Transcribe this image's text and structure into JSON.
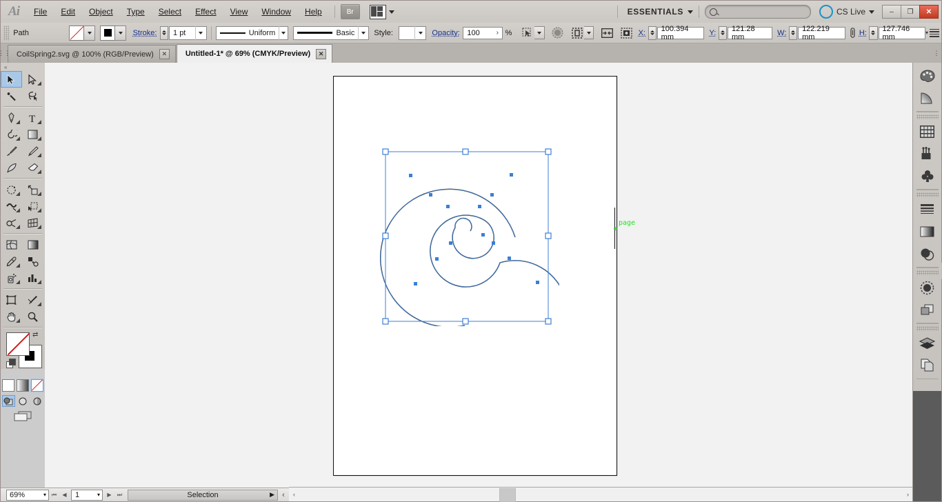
{
  "app": {
    "name": "Adobe Illustrator",
    "logo_text": "Ai"
  },
  "menubar": {
    "items": [
      {
        "label": "File"
      },
      {
        "label": "Edit"
      },
      {
        "label": "Object"
      },
      {
        "label": "Type"
      },
      {
        "label": "Select"
      },
      {
        "label": "Effect"
      },
      {
        "label": "View"
      },
      {
        "label": "Window"
      },
      {
        "label": "Help"
      }
    ],
    "bridge_label": "Br",
    "arrange_icon": "arrange-documents-icon",
    "workspace": "ESSENTIALS",
    "search_placeholder": "",
    "cs_live_label": "CS Live",
    "window_buttons": {
      "minimize": "–",
      "restore": "❐",
      "close": "✕"
    }
  },
  "control_bar": {
    "object_type": "Path",
    "fill_label": "Fill",
    "fill_value": "None",
    "stroke_color_label": "Stroke Color",
    "stroke_color_value": "Black",
    "stroke_label": "Stroke:",
    "stroke_weight": "1 pt",
    "variable_width_profile": "Uniform",
    "brush_definition": "Basic",
    "style_label": "Style:",
    "style_value": "",
    "opacity_label": "Opacity:",
    "opacity_value": "100",
    "opacity_unit": "%",
    "opacity_more": "›",
    "align_icon": "align-to-selection-icon",
    "transform_icon": "transform-icon",
    "isolate_icon": "isolate-selected-object-icon",
    "mask_icon": "edit-clipping-mask-icon",
    "recolor_icon": "recolor-artwork-icon",
    "x_label": "X:",
    "x_value": "100.394 mm",
    "y_label": "Y:",
    "y_value": "121.28 mm",
    "w_label": "W:",
    "w_value": "122.219 mm",
    "link_icon": "constrain-proportions-icon",
    "h_label": "H:",
    "h_value": "127.746 mm",
    "panel_menu_icon": "panel-menu-icon"
  },
  "document_tabs": [
    {
      "label": "CoilSpring2.svg @ 100% (RGB/Preview)",
      "active": false,
      "close": "✕"
    },
    {
      "label": "Untitled-1* @ 69% (CMYK/Preview)",
      "active": true,
      "close": "✕"
    }
  ],
  "toolbox": {
    "tools": [
      {
        "name": "selection-tool",
        "selected": true,
        "has_flyout": false
      },
      {
        "name": "direct-selection-tool",
        "selected": false,
        "has_flyout": true
      },
      {
        "name": "magic-wand-tool",
        "selected": false,
        "has_flyout": false
      },
      {
        "name": "lasso-tool",
        "selected": false,
        "has_flyout": false
      },
      {
        "name": "pen-tool",
        "selected": false,
        "has_flyout": true
      },
      {
        "name": "type-tool",
        "selected": false,
        "has_flyout": true
      },
      {
        "name": "line-segment-tool",
        "selected": false,
        "has_flyout": true
      },
      {
        "name": "rectangle-tool",
        "selected": false,
        "has_flyout": true
      },
      {
        "name": "paintbrush-tool",
        "selected": false,
        "has_flyout": false
      },
      {
        "name": "pencil-tool",
        "selected": false,
        "has_flyout": true
      },
      {
        "name": "blob-brush-tool",
        "selected": false,
        "has_flyout": false
      },
      {
        "name": "eraser-tool",
        "selected": false,
        "has_flyout": true
      },
      {
        "name": "rotate-tool",
        "selected": false,
        "has_flyout": true
      },
      {
        "name": "scale-tool",
        "selected": false,
        "has_flyout": true
      },
      {
        "name": "width-tool",
        "selected": false,
        "has_flyout": true
      },
      {
        "name": "free-transform-tool",
        "selected": false,
        "has_flyout": false
      },
      {
        "name": "shape-builder-tool",
        "selected": false,
        "has_flyout": true
      },
      {
        "name": "perspective-grid-tool",
        "selected": false,
        "has_flyout": true
      },
      {
        "name": "mesh-tool",
        "selected": false,
        "has_flyout": false
      },
      {
        "name": "gradient-tool",
        "selected": false,
        "has_flyout": false
      },
      {
        "name": "eyedropper-tool",
        "selected": false,
        "has_flyout": true
      },
      {
        "name": "blend-tool",
        "selected": false,
        "has_flyout": false
      },
      {
        "name": "symbol-sprayer-tool",
        "selected": false,
        "has_flyout": true
      },
      {
        "name": "column-graph-tool",
        "selected": false,
        "has_flyout": true
      },
      {
        "name": "artboard-tool",
        "selected": false,
        "has_flyout": false
      },
      {
        "name": "slice-tool",
        "selected": false,
        "has_flyout": true
      },
      {
        "name": "hand-tool",
        "selected": false,
        "has_flyout": true
      },
      {
        "name": "zoom-tool",
        "selected": false,
        "has_flyout": false
      }
    ],
    "fill_name": "fill-swatch",
    "fill_value": "None",
    "stroke_name": "stroke-swatch",
    "stroke_value": "Black",
    "swap_label": "⇄",
    "color_modes": [
      {
        "name": "color-mode-button",
        "selected": false
      },
      {
        "name": "gradient-mode-button",
        "selected": false
      },
      {
        "name": "none-mode-button",
        "selected": true
      }
    ],
    "draw_modes": [
      {
        "name": "draw-normal-button",
        "selected": true
      },
      {
        "name": "draw-behind-button",
        "selected": false
      },
      {
        "name": "draw-inside-button",
        "selected": false
      }
    ],
    "screen_mode": "change-screen-mode-button"
  },
  "canvas": {
    "page_label": "page",
    "page_marker": "+",
    "artwork": {
      "name": "spiral-path",
      "description": "Archimedean spiral, 3 turns, black 1pt stroke, no fill",
      "turns": 3,
      "selection": {
        "bounding_box_color": "#3c7fd4",
        "anchor_color": "#3c7fd4"
      }
    }
  },
  "scrollbars": {
    "vertical": {
      "up": "▲",
      "down": "▼"
    },
    "horizontal": {
      "left": "‹",
      "right": "›"
    }
  },
  "statusbar": {
    "zoom_level": "69%",
    "first_page": "⏮",
    "prev_page": "◀",
    "page_number": "1",
    "next_page": "▶",
    "last_page": "⏭",
    "status_text": "Selection",
    "status_menu": "▶",
    "collapse": "‹"
  },
  "dock": {
    "groups": [
      {
        "has_grip": false,
        "buttons": [
          {
            "name": "color-panel-icon",
            "label": "Color"
          },
          {
            "name": "color-guide-panel-icon",
            "label": "Color Guide"
          }
        ]
      },
      {
        "has_grip": true,
        "buttons": [
          {
            "name": "swatches-panel-icon",
            "label": "Swatches"
          },
          {
            "name": "brushes-panel-icon",
            "label": "Brushes"
          },
          {
            "name": "symbols-panel-icon",
            "label": "Symbols"
          }
        ]
      },
      {
        "has_grip": true,
        "buttons": [
          {
            "name": "stroke-panel-icon",
            "label": "Stroke"
          },
          {
            "name": "gradient-panel-icon",
            "label": "Gradient"
          },
          {
            "name": "transparency-panel-icon",
            "label": "Transparency"
          }
        ]
      },
      {
        "has_grip": true,
        "buttons": [
          {
            "name": "appearance-panel-icon",
            "label": "Appearance"
          },
          {
            "name": "graphic-styles-panel-icon",
            "label": "Graphic Styles"
          }
        ]
      },
      {
        "has_grip": true,
        "buttons": [
          {
            "name": "layers-panel-icon",
            "label": "Layers"
          },
          {
            "name": "artboards-panel-icon",
            "label": "Artboards"
          }
        ]
      }
    ]
  }
}
